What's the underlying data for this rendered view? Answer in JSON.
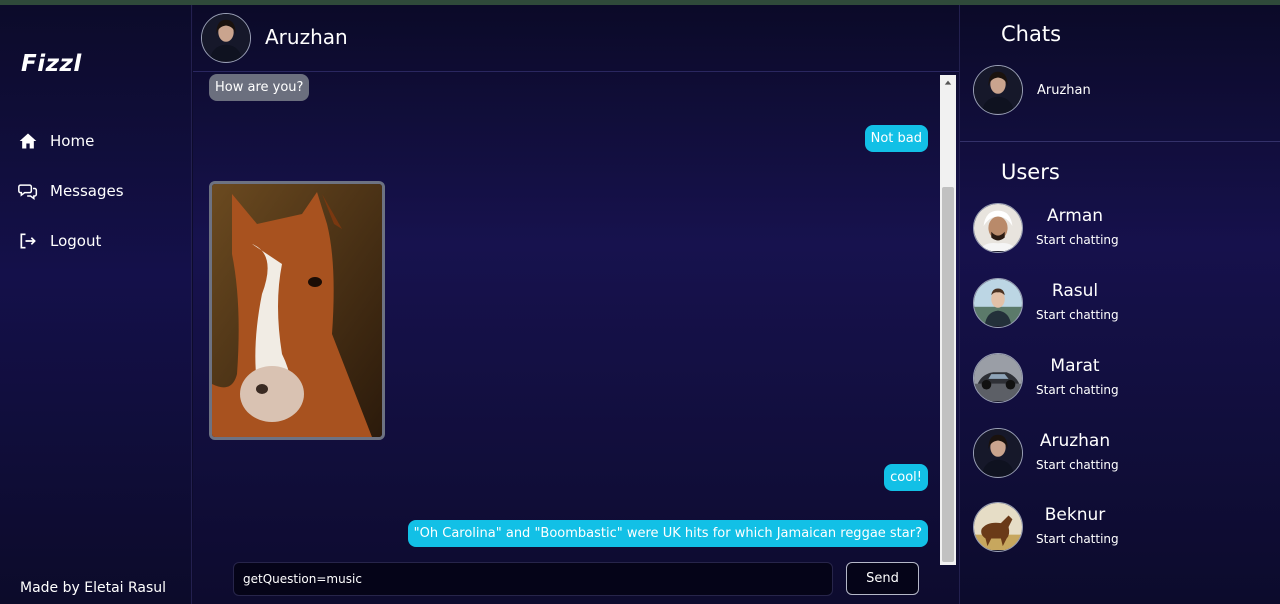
{
  "sidebar": {
    "brand": "Fizzl",
    "nav": [
      {
        "label": "Home",
        "icon": "home-icon"
      },
      {
        "label": "Messages",
        "icon": "chat-bubbles-icon"
      },
      {
        "label": "Logout",
        "icon": "logout-icon"
      }
    ],
    "footer": "Made by Eletai Rasul"
  },
  "chat": {
    "contact_name": "Aruzhan",
    "messages": [
      {
        "text": "How are you?",
        "direction": "incoming"
      },
      {
        "text": "Not bad",
        "direction": "outgoing"
      },
      {
        "text": "cool!",
        "direction": "outgoing"
      },
      {
        "text": "\"Oh Carolina\" and \"Boombastic\" were UK hits for which Jamaican reggae star?",
        "direction": "outgoing"
      }
    ],
    "image_message": {
      "subject": "horse-photo",
      "direction": "incoming"
    },
    "composer": {
      "value": "getQuestion=music",
      "send_label": "Send"
    }
  },
  "right_panel": {
    "chats_title": "Chats",
    "chats": [
      {
        "name": "Aruzhan",
        "avatar": "woman-portrait-avatar"
      }
    ],
    "users_title": "Users",
    "users": [
      {
        "name": "Arman",
        "subtitle": "Start chatting",
        "avatar": "man-headscarf-avatar"
      },
      {
        "name": "Rasul",
        "subtitle": "Start chatting",
        "avatar": "young-man-avatar"
      },
      {
        "name": "Marat",
        "subtitle": "Start chatting",
        "avatar": "sports-car-avatar"
      },
      {
        "name": "Aruzhan",
        "subtitle": "Start chatting",
        "avatar": "woman-portrait-avatar"
      },
      {
        "name": "Beknur",
        "subtitle": "Start chatting",
        "avatar": "horse-avatar"
      }
    ]
  },
  "colors": {
    "outgoing_bubble": "#12c0e6",
    "incoming_bubble": "#6b6f7e",
    "background": "#0d0b2c"
  }
}
